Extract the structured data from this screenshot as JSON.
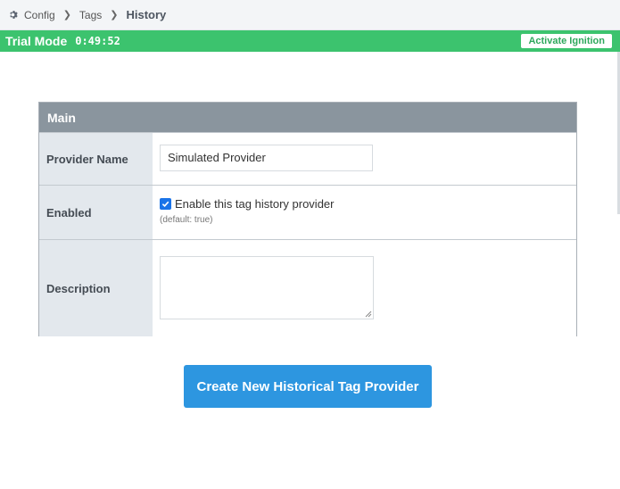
{
  "breadcrumb": {
    "items": [
      "Config",
      "Tags"
    ],
    "current": "History"
  },
  "trial": {
    "mode_label": "Trial Mode",
    "timer": "0:49:52",
    "activate_label": "Activate Ignition"
  },
  "panel": {
    "header": "Main",
    "provider_name": {
      "label": "Provider Name",
      "value": "Simulated Provider"
    },
    "enabled": {
      "label": "Enabled",
      "checkbox_label": "Enable this tag history provider",
      "checked": true,
      "hint": "(default: true)"
    },
    "description": {
      "label": "Description",
      "value": ""
    }
  },
  "create_button": "Create New Historical Tag Provider",
  "colors": {
    "trial_green": "#3cc36e",
    "header_gray": "#8a959e",
    "button_blue": "#2d96e0",
    "label_bg": "#e3e8ed"
  },
  "icons": {
    "breadcrumb_root": "gear-icon",
    "separator": "chevron-right-icon",
    "checkbox": "check-icon"
  }
}
